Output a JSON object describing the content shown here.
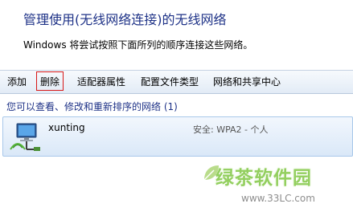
{
  "header": {
    "title": "管理使用(无线网络连接)的无线网络",
    "description": "Windows 将尝试按照下面所列的顺序连接这些网络。"
  },
  "toolbar": {
    "add": "添加",
    "delete": "删除",
    "adapter_properties": "适配器属性",
    "profile_type": "配置文件类型",
    "network_sharing_center": "网络和共享中心"
  },
  "network_list": {
    "label": "您可以查看、修改和重新排序的网络 (1)",
    "items": [
      {
        "name": "xunting",
        "security": "安全: WPA2 - 个人",
        "icon": "wireless-network-icon"
      }
    ]
  },
  "watermark": {
    "logo_text": "绿茶软件园",
    "url": "www.33LC.com"
  },
  "colors": {
    "title": "#1e3287",
    "highlight_border": "#d71818",
    "row_border": "#a8c8ea",
    "watermark_green": "#6fbf2a"
  }
}
